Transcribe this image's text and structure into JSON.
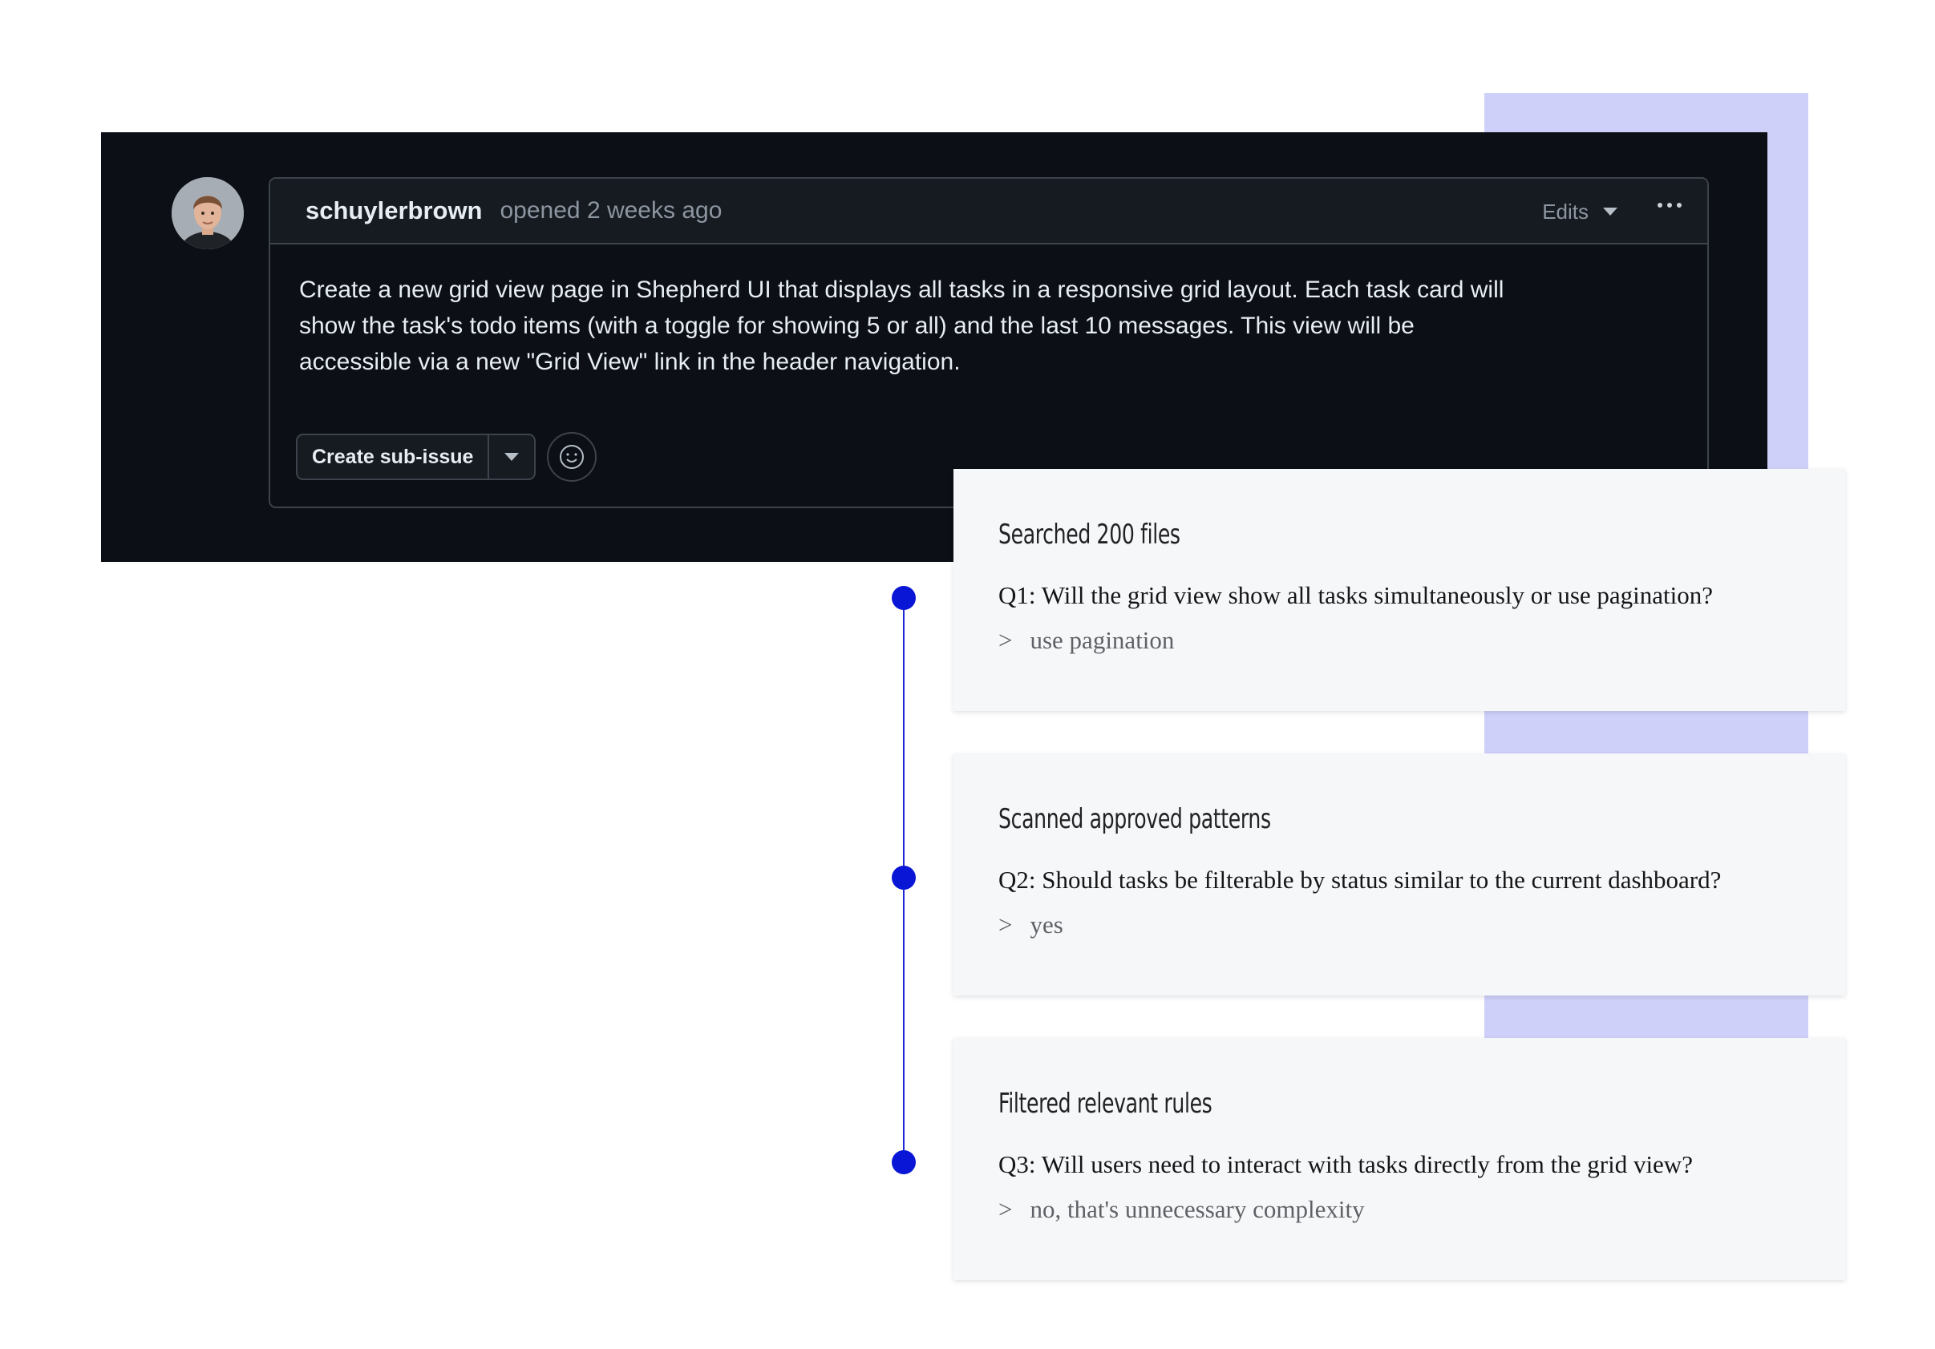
{
  "issue": {
    "author": "schuylerbrown",
    "opened": "opened 2 weeks ago",
    "edits_label": "Edits",
    "body": "Create a new grid view page in Shepherd UI that displays all tasks in a responsive grid layout. Each task card will show the task's todo items (with a toggle for showing 5 or all) and the last 10 messages. This view will be accessible via a new \"Grid View\" link in the header navigation.",
    "create_sub_issue_label": "Create sub-issue"
  },
  "steps": [
    {
      "title": "Searched 200 files",
      "question": "Q1: Will the grid view show all tasks simultaneously or use pagination?",
      "prompt": ">",
      "answer": "use pagination"
    },
    {
      "title": "Scanned approved patterns",
      "question": "Q2: Should tasks be filterable by status similar to the current dashboard?",
      "prompt": ">",
      "answer": "yes"
    },
    {
      "title": "Filtered relevant rules",
      "question": "Q3: Will users need to interact with tasks directly from the grid view?",
      "prompt": ">",
      "answer": "no, that's unnecessary complexity"
    }
  ],
  "colors": {
    "accent_band": "#cfd0f9",
    "timeline": "#0a16d6",
    "panel_background": "#0c0f15"
  },
  "icons": [
    "avatar",
    "caret-down-icon",
    "kebab-menu-icon",
    "smiley-icon"
  ]
}
